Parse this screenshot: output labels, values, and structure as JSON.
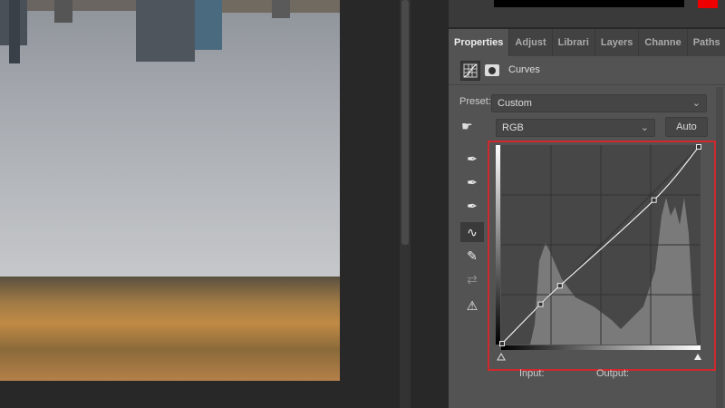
{
  "tabs": [
    "Properties",
    "Adjust",
    "Librari",
    "Layers",
    "Channe",
    "Paths"
  ],
  "header": {
    "title": "Curves"
  },
  "preset": {
    "label": "Preset:",
    "value": "Custom"
  },
  "channel": {
    "value": "RGB"
  },
  "auto_label": "Auto",
  "tools": [
    "sample-black-eyedropper",
    "sample-gray-eyedropper",
    "sample-white-eyedropper",
    "edit-points-curve",
    "draw-pencil",
    "smooth-curve",
    "clipping-warning"
  ],
  "curve": {
    "points": [
      [
        0,
        0
      ],
      [
        50,
        51
      ],
      [
        75,
        75
      ],
      [
        197,
        186
      ],
      [
        255,
        255
      ]
    ]
  },
  "footer": {
    "input_label": "Input:",
    "output_label": "Output:"
  },
  "colors": {
    "accent": "#d0282e"
  }
}
